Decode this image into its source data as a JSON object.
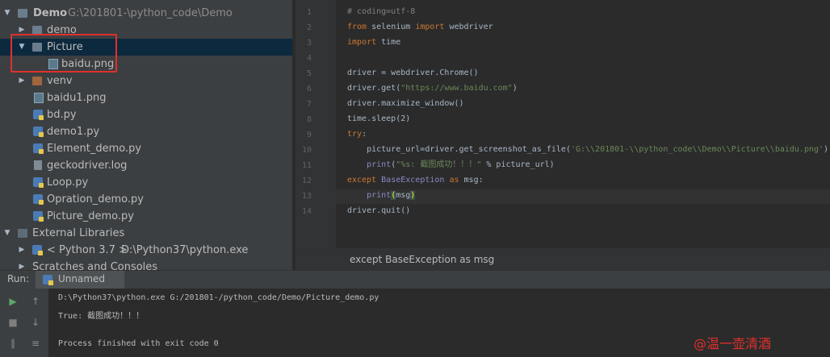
{
  "project_tree": {
    "root_name": "Demo",
    "root_path": "G:\\201801-\\python_code\\Demo",
    "items": [
      {
        "label": "demo"
      },
      {
        "label": "Picture"
      },
      {
        "label": "baidu.png"
      },
      {
        "label": "venv"
      },
      {
        "label": "baidu1.png"
      },
      {
        "label": "bd.py"
      },
      {
        "label": "demo1.py"
      },
      {
        "label": "Element_demo.py"
      },
      {
        "label": "geckodriver.log"
      },
      {
        "label": "Loop.py"
      },
      {
        "label": "Opration_demo.py"
      },
      {
        "label": "Picture_demo.py"
      }
    ],
    "external_libraries": "External Libraries",
    "python_sdk": "< Python 3.7 >",
    "python_sdk_path": "D:\\Python37\\python.exe",
    "scratches": "Scratches and Consoles"
  },
  "editor": {
    "line_numbers": [
      "1",
      "2",
      "3",
      "4",
      "5",
      "6",
      "7",
      "8",
      "9",
      "10",
      "11",
      "12",
      "13",
      "14"
    ],
    "lines": [
      {
        "segments": [
          {
            "t": "# coding=utf-8",
            "c": "cmt"
          }
        ]
      },
      {
        "segments": [
          {
            "t": "from",
            "c": "kw"
          },
          {
            "t": " selenium ",
            "c": ""
          },
          {
            "t": "import",
            "c": "kw"
          },
          {
            "t": " webdriver",
            "c": ""
          }
        ]
      },
      {
        "segments": [
          {
            "t": "import",
            "c": "kw"
          },
          {
            "t": " time",
            "c": ""
          }
        ]
      },
      {
        "segments": []
      },
      {
        "segments": [
          {
            "t": "driver = webdriver.Chrome()",
            "c": ""
          }
        ]
      },
      {
        "segments": [
          {
            "t": "driver.get(",
            "c": ""
          },
          {
            "t": "\"https://www.baidu.com\"",
            "c": "str"
          },
          {
            "t": ")",
            "c": ""
          }
        ]
      },
      {
        "segments": [
          {
            "t": "driver.maximize_window()",
            "c": ""
          }
        ]
      },
      {
        "segments": [
          {
            "t": "time.sleep(2)",
            "c": ""
          }
        ]
      },
      {
        "segments": [
          {
            "t": "try",
            "c": "kw"
          },
          {
            "t": ":",
            "c": ""
          }
        ]
      },
      {
        "segments": [
          {
            "t": "    picture_url=driver.get_screenshot_as_file(",
            "c": ""
          },
          {
            "t": "'G:\\\\201801-\\\\python_code\\\\Demo\\\\Picture\\\\baidu.png'",
            "c": "str"
          },
          {
            "t": ")",
            "c": ""
          }
        ]
      },
      {
        "segments": [
          {
            "t": "    ",
            "c": ""
          },
          {
            "t": "print",
            "c": "cls"
          },
          {
            "t": "(",
            "c": ""
          },
          {
            "t": "\"%s: 截图成功！！！\"",
            "c": "str"
          },
          {
            "t": " % picture_url)",
            "c": ""
          }
        ]
      },
      {
        "segments": [
          {
            "t": "except",
            "c": "kw"
          },
          {
            "t": " ",
            "c": ""
          },
          {
            "t": "BaseException",
            "c": "cls"
          },
          {
            "t": " ",
            "c": ""
          },
          {
            "t": "as",
            "c": "kw"
          },
          {
            "t": " msg:",
            "c": ""
          }
        ]
      },
      {
        "segments": [
          {
            "t": "    ",
            "c": ""
          },
          {
            "t": "print",
            "c": "cls"
          },
          {
            "t": "(",
            "c": "brk"
          },
          {
            "t": "msg",
            "c": ""
          },
          {
            "t": ")",
            "c": "brk"
          }
        ]
      },
      {
        "segments": [
          {
            "t": "driver.quit()",
            "c": ""
          }
        ]
      }
    ],
    "breadcrumb": "except BaseException as msg"
  },
  "run_panel": {
    "label": "Run:",
    "tab_label": "Unnamed",
    "console_lines": [
      "D:\\Python37\\python.exe G:/201801-/python_code/Demo/Picture_demo.py",
      "True: 截图成功！！！",
      "",
      "Process finished with exit code 0"
    ]
  },
  "watermark": "@温一壶清酒",
  "colors": {
    "red_highlight": "#e0302d",
    "selection": "#0d293e",
    "keyword": "#cc7832",
    "string": "#6a8759"
  }
}
